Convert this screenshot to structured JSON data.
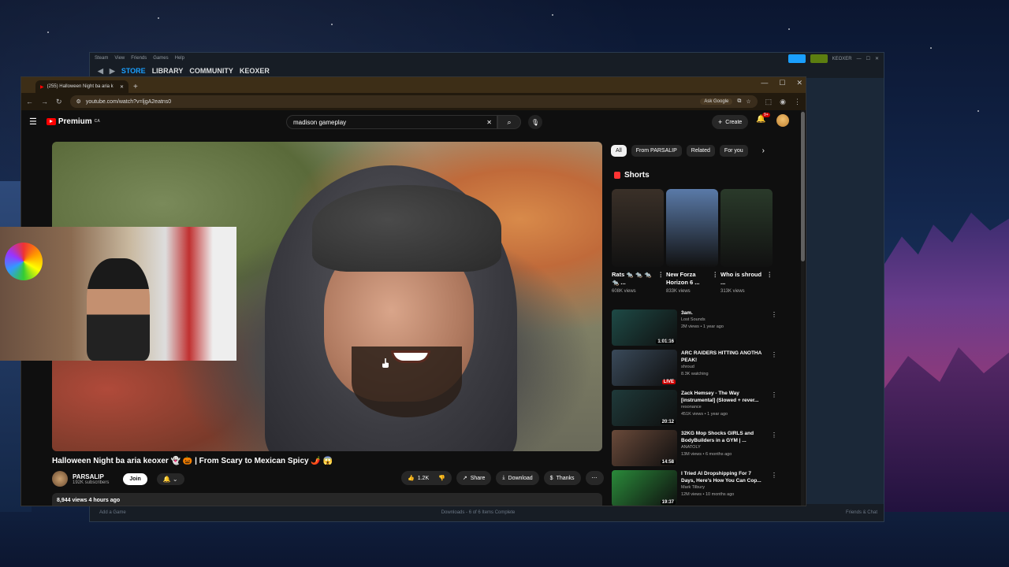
{
  "steam": {
    "menu": [
      "Steam",
      "View",
      "Friends",
      "Games",
      "Help"
    ],
    "nav": [
      "STORE",
      "LIBRARY",
      "COMMUNITY",
      "KEOXER"
    ],
    "user": "KEOXER",
    "bottom": {
      "add_game": "Add a Game",
      "downloads": "Downloads - 6 of 6 Items Complete",
      "friends": "Friends & Chat"
    }
  },
  "browser": {
    "tab_title": "(255) Halloween Night ba aria k",
    "url": "youtube.com/watch?v=ljgA2eatns0",
    "ask_google": "Ask Google"
  },
  "yt": {
    "logo": "Premium",
    "logo_region": "CA",
    "search_value": "madison gameplay",
    "create": "Create",
    "notif_badge": "9+",
    "video": {
      "title": "Halloween Night ba aria keoxer 👻 🎃 | From Scary to Mexican Spicy 🌶️ 😱",
      "channel": "PARSALIP",
      "subscribers": "192K subscribers",
      "join": "Join",
      "likes": "1.2K",
      "share": "Share",
      "download": "Download",
      "thanks": "Thanks",
      "views_date": "8,944 views  4 hours ago"
    },
    "chips": [
      "All",
      "From PARSALIP",
      "Related",
      "For you"
    ],
    "shorts_heading": "Shorts",
    "shorts": [
      {
        "title": "Rats 🐀 🐀 🐀 🐀 ...",
        "views": "608K views",
        "color": "#3a3028"
      },
      {
        "title": "New Forza Horizon 6 ...",
        "views": "833K views",
        "color": "#5a7aa8"
      },
      {
        "title": "Who is shroud ...",
        "views": "313K views",
        "color": "#2a3a2a"
      }
    ],
    "recs": [
      {
        "title": "3am.",
        "channel": "Lost Sounds",
        "meta": "2M views • 1 year ago",
        "dur": "1:01:16",
        "live": false,
        "color": "#1e4a46"
      },
      {
        "title": "ARC RAIDERS HITTING ANOTHA PEAK!",
        "channel": "shroud",
        "meta": "8.3K watching",
        "dur": "LIVE",
        "live": true,
        "color": "#3a4a5a"
      },
      {
        "title": "Zack Hemsey - The Way [instrumental] (Slowed + rever...",
        "channel": "resonance",
        "meta": "451K views • 1 year ago",
        "dur": "20:12",
        "live": false,
        "color": "#1f3a3a"
      },
      {
        "title": "32KG Mop Shocks GIRLS and BodyBuilders in a GYM | ...",
        "channel": "ANATOLY",
        "meta": "13M views • 6 months ago",
        "dur": "14:58",
        "live": false,
        "color": "#6a4a3a"
      },
      {
        "title": "I Tried AI Dropshipping For 7 Days, Here's How You Can Cop...",
        "channel": "Mark Tilbury",
        "meta": "12M views • 10 months ago",
        "dur": "19:37",
        "live": false,
        "color": "#2a8a3a"
      }
    ]
  }
}
